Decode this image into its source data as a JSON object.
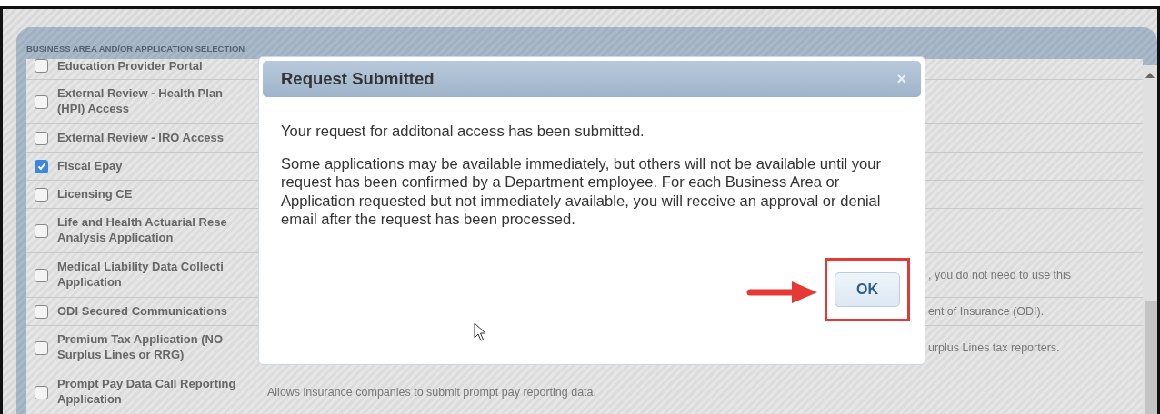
{
  "panel": {
    "title": "BUSINESS AREA AND/OR APPLICATION SELECTION",
    "rows": [
      {
        "name": "Education Provider Portal",
        "checked": false
      },
      {
        "name": "External Review - Health Plan (HPI) Access",
        "checked": false
      },
      {
        "name": "External Review - IRO Access",
        "checked": false
      },
      {
        "name": "Fiscal Epay",
        "checked": true
      },
      {
        "name": "Licensing CE",
        "checked": false
      },
      {
        "name": "Life and Health Actuarial Rese Analysis Application",
        "checked": false
      },
      {
        "name": "Medical Liability Data Collecti Application",
        "checked": false,
        "description": ", you do not need to use this"
      },
      {
        "name": "ODI Secured Communications",
        "checked": false,
        "description": "ent of Insurance (ODI)."
      },
      {
        "name": "Premium Tax Application (NO Surplus Lines or RRG)",
        "checked": false,
        "description": "urplus Lines tax reporters."
      },
      {
        "name": "Prompt Pay Data Call Reporting Application",
        "checked": false,
        "description": "Allows insurance companies to submit prompt pay reporting data."
      }
    ]
  },
  "dialog": {
    "title": "Request Submitted",
    "close": "×",
    "paragraphs": [
      "Your request for additonal access has been submitted.",
      "Some applications may be available immediately, but others will not be available until your request has been confirmed by a Department employee. For each Business Area or Application requested but not immediately available, you will receive an approval or denial email after the request has been processed."
    ],
    "ok": "OK"
  }
}
